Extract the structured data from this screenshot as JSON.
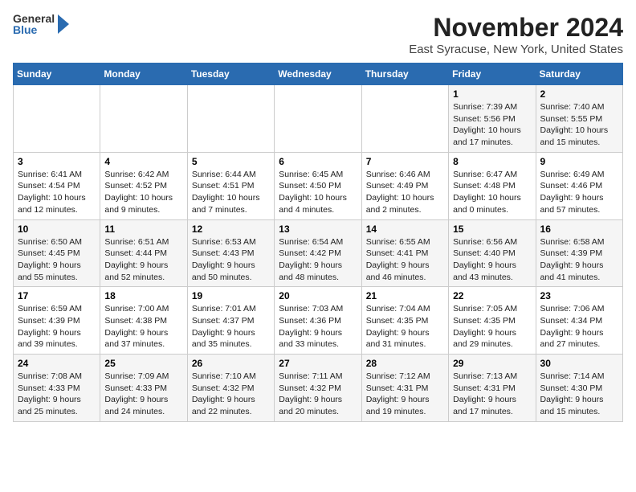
{
  "header": {
    "logo_line1": "General",
    "logo_line2": "Blue",
    "title": "November 2024",
    "subtitle": "East Syracuse, New York, United States"
  },
  "calendar": {
    "weekdays": [
      "Sunday",
      "Monday",
      "Tuesday",
      "Wednesday",
      "Thursday",
      "Friday",
      "Saturday"
    ],
    "weeks": [
      [
        {
          "day": "",
          "info": ""
        },
        {
          "day": "",
          "info": ""
        },
        {
          "day": "",
          "info": ""
        },
        {
          "day": "",
          "info": ""
        },
        {
          "day": "",
          "info": ""
        },
        {
          "day": "1",
          "info": "Sunrise: 7:39 AM\nSunset: 5:56 PM\nDaylight: 10 hours and 17 minutes."
        },
        {
          "day": "2",
          "info": "Sunrise: 7:40 AM\nSunset: 5:55 PM\nDaylight: 10 hours and 15 minutes."
        }
      ],
      [
        {
          "day": "3",
          "info": "Sunrise: 6:41 AM\nSunset: 4:54 PM\nDaylight: 10 hours and 12 minutes."
        },
        {
          "day": "4",
          "info": "Sunrise: 6:42 AM\nSunset: 4:52 PM\nDaylight: 10 hours and 9 minutes."
        },
        {
          "day": "5",
          "info": "Sunrise: 6:44 AM\nSunset: 4:51 PM\nDaylight: 10 hours and 7 minutes."
        },
        {
          "day": "6",
          "info": "Sunrise: 6:45 AM\nSunset: 4:50 PM\nDaylight: 10 hours and 4 minutes."
        },
        {
          "day": "7",
          "info": "Sunrise: 6:46 AM\nSunset: 4:49 PM\nDaylight: 10 hours and 2 minutes."
        },
        {
          "day": "8",
          "info": "Sunrise: 6:47 AM\nSunset: 4:48 PM\nDaylight: 10 hours and 0 minutes."
        },
        {
          "day": "9",
          "info": "Sunrise: 6:49 AM\nSunset: 4:46 PM\nDaylight: 9 hours and 57 minutes."
        }
      ],
      [
        {
          "day": "10",
          "info": "Sunrise: 6:50 AM\nSunset: 4:45 PM\nDaylight: 9 hours and 55 minutes."
        },
        {
          "day": "11",
          "info": "Sunrise: 6:51 AM\nSunset: 4:44 PM\nDaylight: 9 hours and 52 minutes."
        },
        {
          "day": "12",
          "info": "Sunrise: 6:53 AM\nSunset: 4:43 PM\nDaylight: 9 hours and 50 minutes."
        },
        {
          "day": "13",
          "info": "Sunrise: 6:54 AM\nSunset: 4:42 PM\nDaylight: 9 hours and 48 minutes."
        },
        {
          "day": "14",
          "info": "Sunrise: 6:55 AM\nSunset: 4:41 PM\nDaylight: 9 hours and 46 minutes."
        },
        {
          "day": "15",
          "info": "Sunrise: 6:56 AM\nSunset: 4:40 PM\nDaylight: 9 hours and 43 minutes."
        },
        {
          "day": "16",
          "info": "Sunrise: 6:58 AM\nSunset: 4:39 PM\nDaylight: 9 hours and 41 minutes."
        }
      ],
      [
        {
          "day": "17",
          "info": "Sunrise: 6:59 AM\nSunset: 4:39 PM\nDaylight: 9 hours and 39 minutes."
        },
        {
          "day": "18",
          "info": "Sunrise: 7:00 AM\nSunset: 4:38 PM\nDaylight: 9 hours and 37 minutes."
        },
        {
          "day": "19",
          "info": "Sunrise: 7:01 AM\nSunset: 4:37 PM\nDaylight: 9 hours and 35 minutes."
        },
        {
          "day": "20",
          "info": "Sunrise: 7:03 AM\nSunset: 4:36 PM\nDaylight: 9 hours and 33 minutes."
        },
        {
          "day": "21",
          "info": "Sunrise: 7:04 AM\nSunset: 4:35 PM\nDaylight: 9 hours and 31 minutes."
        },
        {
          "day": "22",
          "info": "Sunrise: 7:05 AM\nSunset: 4:35 PM\nDaylight: 9 hours and 29 minutes."
        },
        {
          "day": "23",
          "info": "Sunrise: 7:06 AM\nSunset: 4:34 PM\nDaylight: 9 hours and 27 minutes."
        }
      ],
      [
        {
          "day": "24",
          "info": "Sunrise: 7:08 AM\nSunset: 4:33 PM\nDaylight: 9 hours and 25 minutes."
        },
        {
          "day": "25",
          "info": "Sunrise: 7:09 AM\nSunset: 4:33 PM\nDaylight: 9 hours and 24 minutes."
        },
        {
          "day": "26",
          "info": "Sunrise: 7:10 AM\nSunset: 4:32 PM\nDaylight: 9 hours and 22 minutes."
        },
        {
          "day": "27",
          "info": "Sunrise: 7:11 AM\nSunset: 4:32 PM\nDaylight: 9 hours and 20 minutes."
        },
        {
          "day": "28",
          "info": "Sunrise: 7:12 AM\nSunset: 4:31 PM\nDaylight: 9 hours and 19 minutes."
        },
        {
          "day": "29",
          "info": "Sunrise: 7:13 AM\nSunset: 4:31 PM\nDaylight: 9 hours and 17 minutes."
        },
        {
          "day": "30",
          "info": "Sunrise: 7:14 AM\nSunset: 4:30 PM\nDaylight: 9 hours and 15 minutes."
        }
      ]
    ]
  }
}
